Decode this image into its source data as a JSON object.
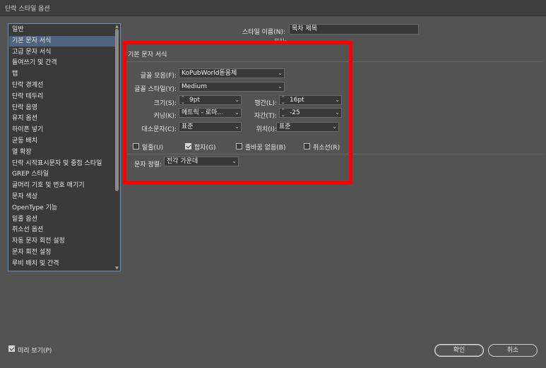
{
  "window": {
    "title": "단락 스타일 옵션"
  },
  "sidebar": {
    "items": [
      "일반",
      "기본 문자 서식",
      "고급 문자 서식",
      "들여쓰기 및 간격",
      "탭",
      "단락 경계선",
      "단락 테두리",
      "단락 음영",
      "유지 옵션",
      "하이픈 넣기",
      "균등 배치",
      "열 확장",
      "단락 시작표시문자 및 중첩 스타일",
      "GREP 스타일",
      "글머리 기호 및 번호 매기기",
      "문자 색상",
      "OpenType 기능",
      "밑줄 옵션",
      "취소선 옵션",
      "자동 문자 회전 설정",
      "문자 회전 설정",
      "루비 배치 및 간격"
    ],
    "selected_index": 1
  },
  "style_name": {
    "label": "스타일 이름(N):",
    "value": "목차 제목"
  },
  "location_label": "위치:",
  "section_title": "기본 문자 서식",
  "fields": {
    "font_family": {
      "label": "글꼴 모음(F):",
      "value": "KoPubWorld돋움체"
    },
    "font_style": {
      "label": "글꼴 스타일(Y):",
      "value": "Medium"
    },
    "size": {
      "label": "크기(S):",
      "value": "9pt"
    },
    "leading": {
      "label": "행간(L):",
      "value": "16pt"
    },
    "kerning": {
      "label": "커닝(K):",
      "value": "메트릭 - 로마..."
    },
    "tracking": {
      "label": "자간(T):",
      "value": "-25"
    },
    "case": {
      "label": "대소문자(C):",
      "value": "표준"
    },
    "position": {
      "label": "위치(I):",
      "value": "표준"
    }
  },
  "checks": {
    "underline": {
      "label": "밑줄(U)",
      "checked": false
    },
    "ligatures": {
      "label": "합자(G)",
      "checked": true
    },
    "no_break": {
      "label": "줄바꿈 없음(B)",
      "checked": false
    },
    "strikethrough": {
      "label": "취소선(R)",
      "checked": false
    }
  },
  "char_align": {
    "label": "문자 정렬:",
    "value": "전각 가운데"
  },
  "preview": {
    "label": "미리 보기(P)",
    "checked": true
  },
  "buttons": {
    "ok": "확인",
    "cancel": "취소"
  }
}
